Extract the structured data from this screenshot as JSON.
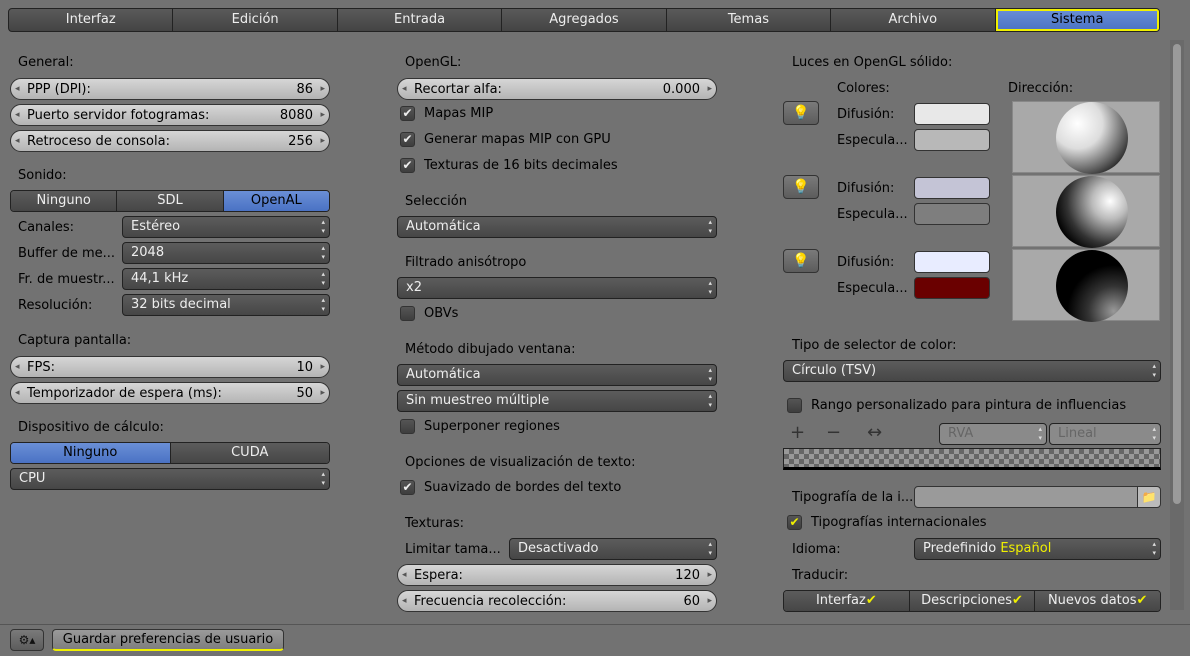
{
  "tabs": [
    "Interfaz",
    "Edición",
    "Entrada",
    "Agregados",
    "Temas",
    "Archivo",
    "Sistema"
  ],
  "general": {
    "title": "General:",
    "dpi_label": "PPP (DPI):",
    "dpi_value": "86",
    "port_label": "Puerto servidor fotogramas:",
    "port_value": "8080",
    "scrollback_label": "Retroceso de consola:",
    "scrollback_value": "256"
  },
  "sound": {
    "title": "Sonido:",
    "options": [
      "Ninguno",
      "SDL",
      "OpenAL"
    ],
    "channels_label": "Canales:",
    "channels_value": "Estéreo",
    "buffer_label": "Buffer de me...",
    "buffer_value": "2048",
    "rate_label": "Fr. de muestr...",
    "rate_value": "44,1 kHz",
    "res_label": "Resolución:",
    "res_value": "32 bits decimal"
  },
  "capture": {
    "title": "Captura pantalla:",
    "fps_label": "FPS:",
    "fps_value": "10",
    "timer_label": "Temporizador de espera (ms):",
    "timer_value": "50"
  },
  "compute": {
    "title": "Dispositivo de cálculo:",
    "options": [
      "Ninguno",
      "CUDA"
    ],
    "device_value": "CPU"
  },
  "opengl": {
    "title": "OpenGL:",
    "clip_label": "Recortar alfa:",
    "clip_value": "0.000",
    "mip": "Mapas MIP",
    "mip_gpu": "Generar mapas MIP con GPU",
    "tex16": "Texturas de 16 bits decimales"
  },
  "selection": {
    "title": "Selección",
    "value": "Automática"
  },
  "aniso": {
    "title": "Filtrado anisótropo",
    "value": "x2",
    "vbo": "OBVs"
  },
  "window_draw": {
    "title": "Método dibujado ventana:",
    "value": "Automática",
    "multisample": "Sin muestreo múltiple",
    "overlap": "Superponer regiones"
  },
  "text_opts": {
    "title": "Opciones de visualización de texto:",
    "aa": "Suavizado de bordes del texto"
  },
  "textures": {
    "title": "Texturas:",
    "limit_label": "Limitar tama...",
    "limit_value": "Desactivado",
    "wait_label": "Espera:",
    "wait_value": "120",
    "freq_label": "Frecuencia recolección:",
    "freq_value": "60"
  },
  "lights": {
    "title": "Luces en OpenGL sólido:",
    "colors": "Colores:",
    "direction": "Dirección:",
    "diffuse": "Difusión:",
    "specular": "Especula...",
    "sw": [
      "#e8e8e8",
      "#b8b8b8",
      "#c4c4d6",
      "#7e7e7e",
      "#e8ecff",
      "#6a0000"
    ]
  },
  "picker": {
    "title": "Tipo de selector de color:",
    "value": "Círculo (TSV)",
    "range": "Rango personalizado para pintura de influencias",
    "plus": "+",
    "minus": "−",
    "arrows": "↔",
    "rgb": "RVA",
    "linear": "Lineal"
  },
  "font": {
    "label": "Tipografía de la i...",
    "intl": "Tipografías internacionales",
    "lang_label": "Idioma:",
    "lang_default": "Predefinido",
    "lang_value": "Español",
    "translate": "Traducir:",
    "tr": [
      "Interfaz",
      "Descripciones",
      "Nuevos datos"
    ]
  },
  "save": "Guardar preferencias de usuario",
  "colors": {
    "accent": "#4a72c4",
    "highlight": "#f0f000"
  }
}
